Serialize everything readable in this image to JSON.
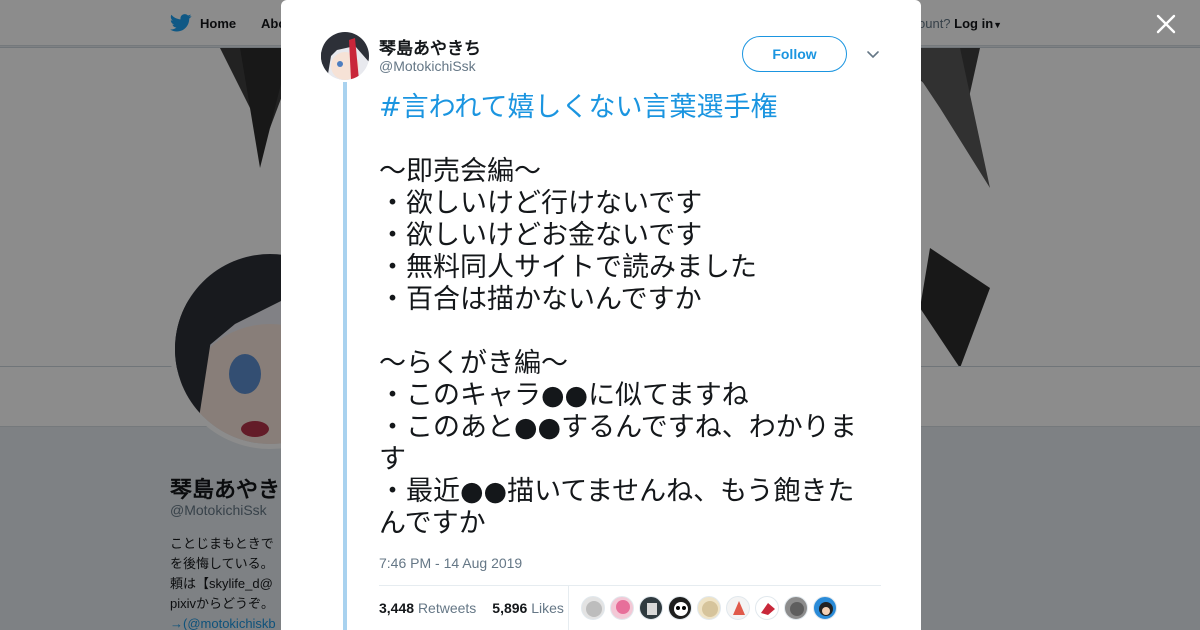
{
  "background": {
    "nav": {
      "home_label": "Home",
      "about_label": "Abo",
      "account_text": "ccount?",
      "login_label": "Log in"
    },
    "profile": {
      "name": "琴島あやきち",
      "handle": "@MotokichiSsk",
      "bio_lines": [
        "ことじまもときで",
        "を後悔している。",
        "頼は【skylife_d@",
        "pixivからどうぞ。"
      ],
      "bio_link": "→(@motokichiskb"
    }
  },
  "tweet": {
    "display_name": "琴島あやきち",
    "screen_name": "@MotokichiSsk",
    "follow_label": "Follow",
    "hashtag": "#言われて嬉しくない言葉選手権",
    "body": "\n\n～即売会編～\n・欲しいけど行けないです\n・欲しいけどお金ないです\n・無料同人サイトで読みました\n・百合は描かないんですか\n\n～らくがき編～\n・このキャラ●●に似てますね\n・このあと●●するんですね、わかります\n・最近●●描いてませんね、もう飽きたんですか",
    "timestamp": "7:46 PM - 14 Aug 2019",
    "retweets_count": "3,448",
    "retweets_label": "Retweets",
    "likes_count": "5,896",
    "likes_label": "Likes"
  },
  "icons": [
    "twitter-bird-icon",
    "close-icon",
    "chevron-down-icon",
    "caret-down-icon"
  ],
  "colors": {
    "accent": "#1b95e0",
    "thread_line": "#a9d2ef",
    "text": "#14171a",
    "muted": "#657786"
  }
}
